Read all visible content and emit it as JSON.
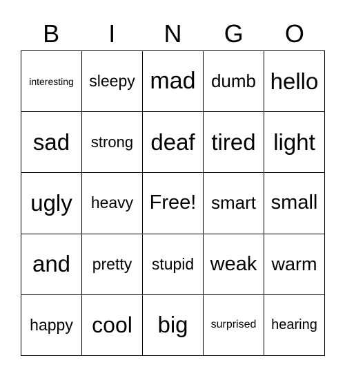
{
  "header": [
    "B",
    "I",
    "N",
    "G",
    "O"
  ],
  "cells": [
    "interesting",
    "sleepy",
    "mad",
    "dumb",
    "hello",
    "sad",
    "strong",
    "deaf",
    "tired",
    "light",
    "ugly",
    "heavy",
    "Free!",
    "smart",
    "small",
    "and",
    "pretty",
    "stupid",
    "weak",
    "warm",
    "happy",
    "cool",
    "big",
    "surprised",
    "hearing"
  ]
}
